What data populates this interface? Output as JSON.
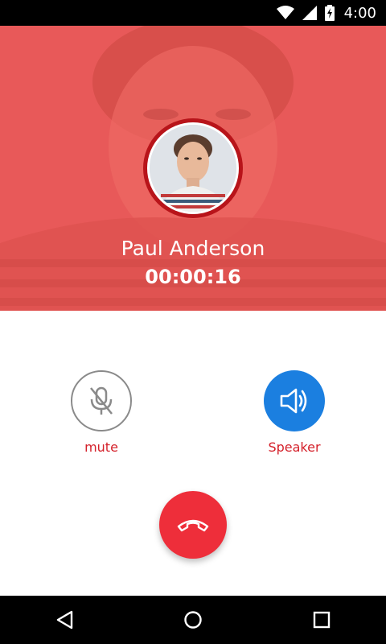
{
  "status_bar": {
    "time": "4:00",
    "icons": [
      "wifi-icon",
      "cell-signal-icon",
      "battery-charging-icon"
    ]
  },
  "call": {
    "caller_name": "Paul Anderson",
    "duration": "00:00:16"
  },
  "controls": {
    "mute": {
      "label": "mute",
      "icon": "mic-off-icon",
      "active": false
    },
    "speaker": {
      "label": "Speaker",
      "icon": "speaker-icon",
      "active": true
    },
    "end_call": {
      "icon": "end-call-icon"
    }
  },
  "nav": {
    "items": [
      "back-icon",
      "home-icon",
      "recents-icon"
    ]
  },
  "colors": {
    "header_tint": "#e95a5a",
    "accent_red": "#d4202a",
    "end_call": "#ee2e3a",
    "speaker_active": "#1b7fe0",
    "avatar_ring": "#b8141a"
  }
}
